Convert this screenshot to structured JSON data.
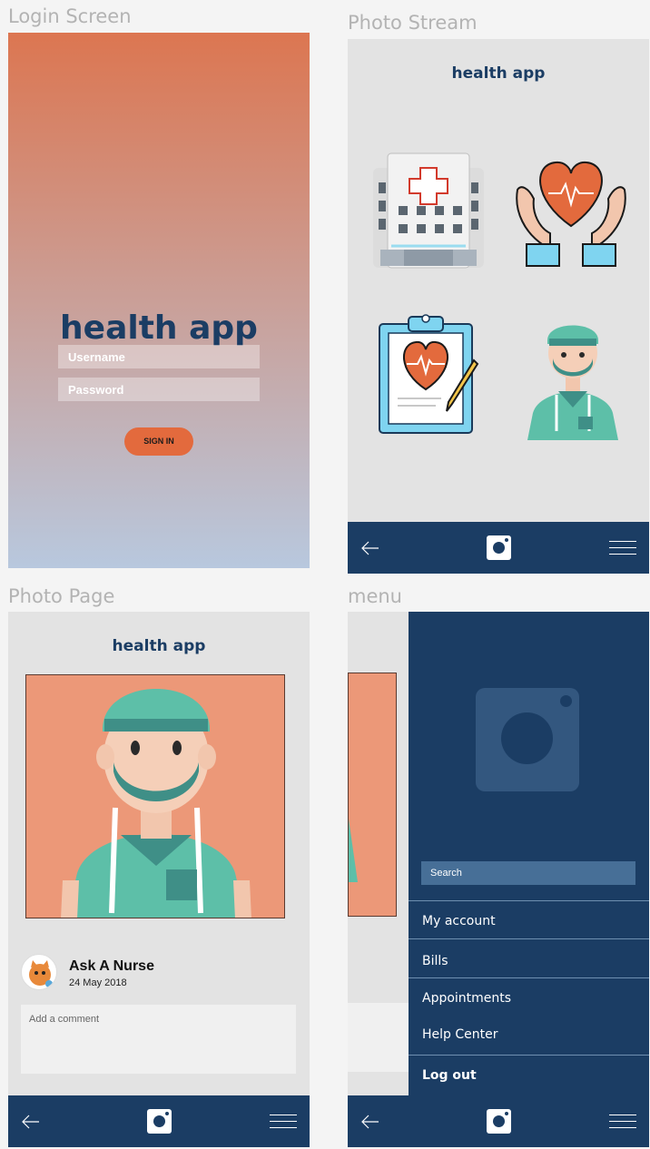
{
  "labels": {
    "login_screen": "Login Screen",
    "photo_stream": "Photo Stream",
    "photo_page": "Photo Page",
    "menu": "menu"
  },
  "app": {
    "name": "health app"
  },
  "login": {
    "username_placeholder": "Username",
    "password_placeholder": "Password",
    "sign_in": "SIGN IN"
  },
  "photo_page": {
    "author": "Ask A Nurse",
    "date": "24 May 2018",
    "comment_placeholder": "Add a comment"
  },
  "menu": {
    "search_placeholder": "Search",
    "items": [
      {
        "label": "My account"
      },
      {
        "label": "Bills"
      },
      {
        "label": "Appointments"
      },
      {
        "label": "Help Center"
      },
      {
        "label": "Log out"
      }
    ]
  },
  "icons": {
    "back": "back-arrow-icon",
    "camera": "camera-icon",
    "menu": "hamburger-icon",
    "tiles": [
      "hospital-icon",
      "heart-hands-icon",
      "clipboard-heart-icon",
      "nurse-icon"
    ]
  },
  "colors": {
    "navy": "#1b3d64",
    "accent": "#e36a3d",
    "gradient_top": "#dc7651",
    "gradient_bottom": "#b8c8de",
    "photo_bg": "#ec9878",
    "drawer_logo": "#33577f"
  }
}
